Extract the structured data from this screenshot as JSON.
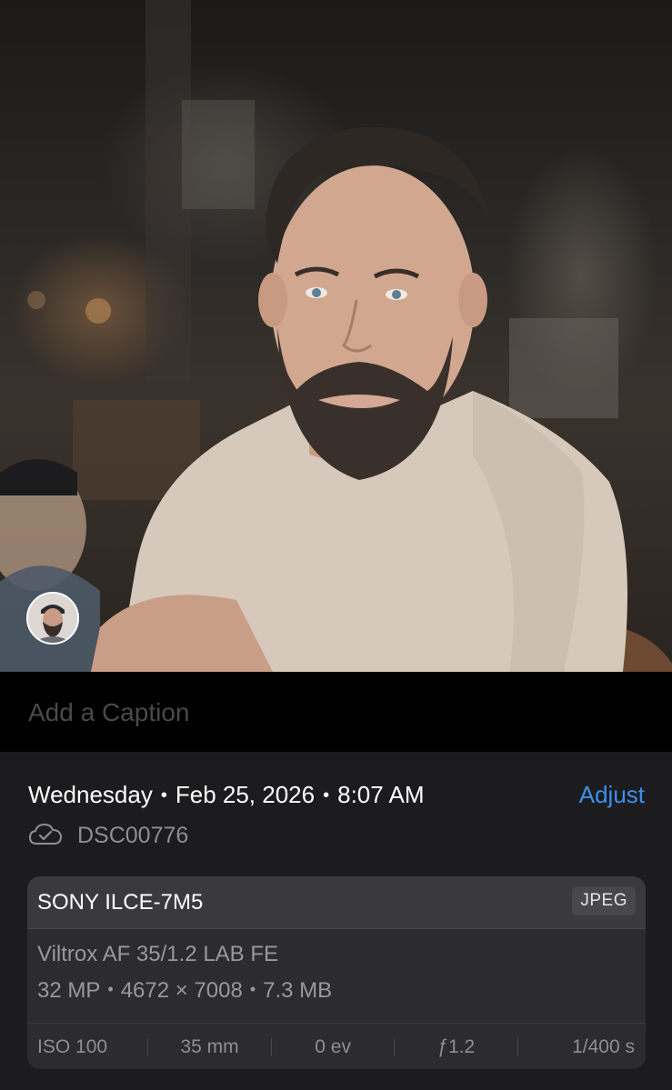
{
  "photo": {
    "description_icon": "portrait-photo",
    "avatar_icon": "face-avatar-icon"
  },
  "caption": {
    "placeholder": "Add a Caption"
  },
  "info": {
    "day": "Wednesday",
    "date": "Feb 25, 2026",
    "time": "8:07 AM",
    "separator": "•",
    "adjust_label": "Adjust",
    "cloud_icon": "cloud-checkmark-icon",
    "file_name": "DSC00776"
  },
  "camera": {
    "model": "SONY ILCE-7M5",
    "format": "JPEG",
    "lens": "Viltrox AF 35/1.2 LAB FE",
    "megapixels": "32 MP",
    "dimensions": "4672 × 7008",
    "size": "7.3 MB",
    "exif": [
      {
        "key": "iso",
        "label": "ISO 100"
      },
      {
        "key": "focal",
        "label": "35 mm"
      },
      {
        "key": "ev",
        "label": "0 ev"
      },
      {
        "key": "aperture",
        "label": "ƒ1.2"
      },
      {
        "key": "shutter",
        "label": "1/400 s"
      }
    ]
  },
  "colors": {
    "accent": "#3d8ff0",
    "panel": "#1c1c1e",
    "card": "#2c2c2e"
  }
}
